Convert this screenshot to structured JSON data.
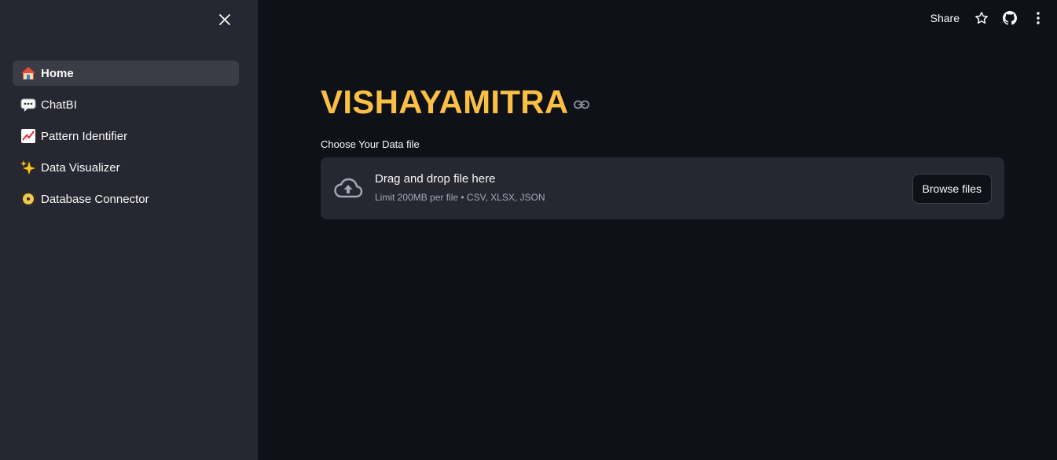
{
  "sidebar": {
    "items": [
      {
        "label": "Home",
        "icon": "house-emoji"
      },
      {
        "label": "ChatBI",
        "icon": "speech-bubble-emoji"
      },
      {
        "label": "Pattern Identifier",
        "icon": "chart-increasing-emoji"
      },
      {
        "label": "Data Visualizer",
        "icon": "sparkles-emoji"
      },
      {
        "label": "Database Connector",
        "icon": "optical-disc-emoji"
      }
    ],
    "active_index": 0
  },
  "header": {
    "share_label": "Share",
    "icons": [
      "star-icon",
      "github-icon",
      "more-vertical-icon"
    ]
  },
  "main": {
    "title": "VISHAYAMITRA",
    "uploader": {
      "label": "Choose Your Data file",
      "dropzone_title": "Drag and drop file here",
      "limit_text": "Limit 200MB per file • CSV, XLSX, JSON",
      "browse_label": "Browse files"
    }
  },
  "colors": {
    "background": "#0e1117",
    "sidebar": "#262730",
    "title_accent": "#fbbf45",
    "text": "#fafafa",
    "muted_text": "#a3a8b8"
  }
}
